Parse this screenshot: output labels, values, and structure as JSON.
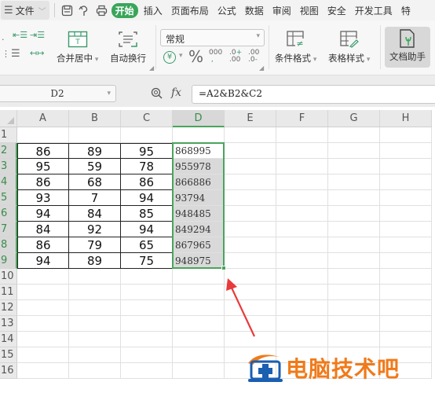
{
  "menubar": {
    "file_label": "文件",
    "tabs": [
      "开始",
      "插入",
      "页面布局",
      "公式",
      "数据",
      "审阅",
      "视图",
      "安全",
      "开发工具",
      "特"
    ],
    "active_tab": "开始",
    "quick_access": [
      "save-icon",
      "undo-icon",
      "print-icon"
    ]
  },
  "ribbon": {
    "merge_center_label": "合并居中",
    "wrap_text_label": "自动换行",
    "number_format_value": "常规",
    "currency_symbol": "¥",
    "percent_symbol": "%",
    "thousands_symbol": "000",
    "increase_decimal": ".0+\n.00",
    "decrease_decimal": ".00\n.0-",
    "conditional_format_label": "条件格式",
    "table_style_label": "表格样式",
    "doc_helper_label": "文档助手"
  },
  "formula_bar": {
    "name_box": "D2",
    "fx_label": "fx",
    "formula": "=A2&B2&C2"
  },
  "sheet": {
    "columns": [
      "A",
      "B",
      "C",
      "D",
      "E",
      "F",
      "G",
      "H"
    ],
    "selected_column": "D",
    "rows": [
      "1",
      "2",
      "3",
      "4",
      "5",
      "6",
      "7",
      "8",
      "9",
      "10",
      "11",
      "12",
      "13",
      "14",
      "15",
      "16"
    ],
    "data": [
      [
        "86",
        "89",
        "95",
        "868995"
      ],
      [
        "95",
        "59",
        "78",
        "955978"
      ],
      [
        "86",
        "68",
        "86",
        "866886"
      ],
      [
        "93",
        "7",
        "94",
        "93794"
      ],
      [
        "94",
        "84",
        "85",
        "948485"
      ],
      [
        "84",
        "92",
        "94",
        "849294"
      ],
      [
        "86",
        "79",
        "65",
        "867965"
      ],
      [
        "94",
        "89",
        "75",
        "948975"
      ]
    ],
    "active_cell": "D2",
    "selection_range": "D2:D9"
  },
  "watermark": {
    "text": "电脑技术吧",
    "accent_color": "#f07a1a"
  },
  "colors": {
    "accent_green": "#4aa45c",
    "active_tab_bg": "#3aa55a",
    "arrow_red": "#e83a3a"
  }
}
